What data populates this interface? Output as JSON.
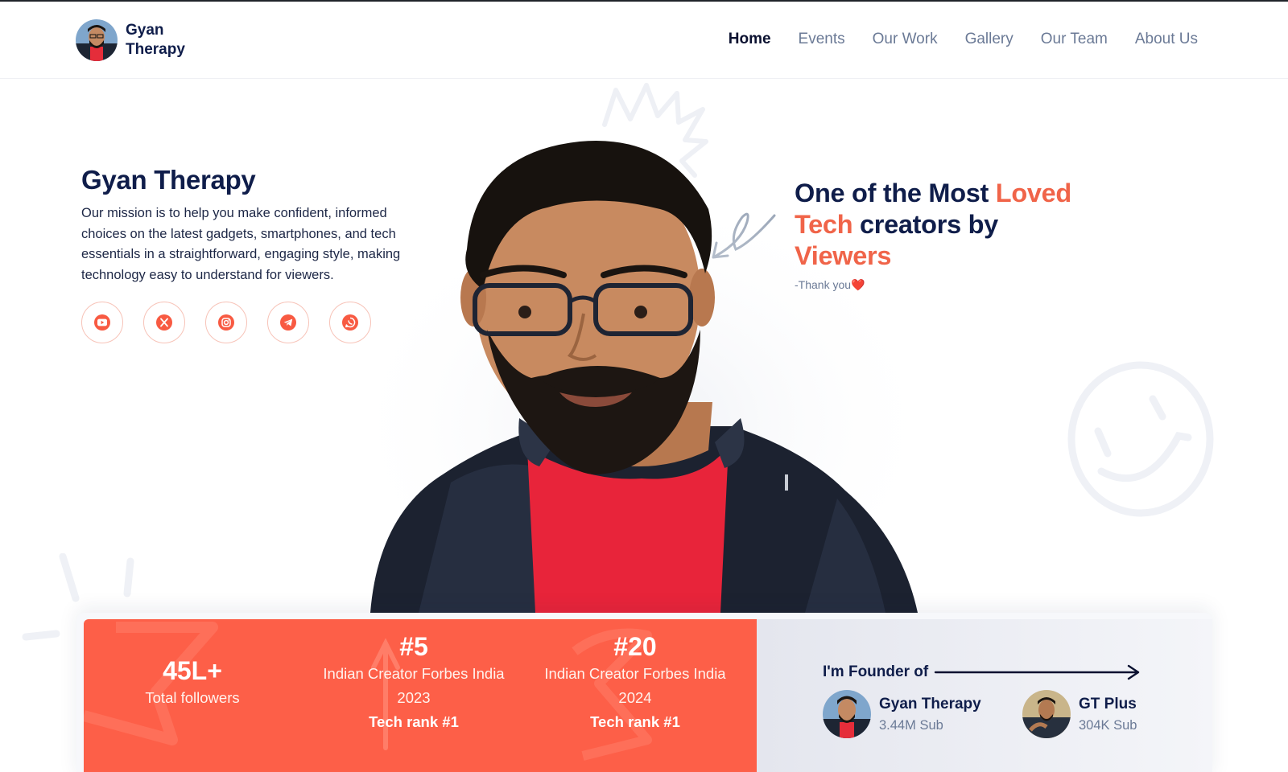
{
  "brand": {
    "name": "Gyan Therapy"
  },
  "nav": {
    "items": [
      {
        "label": "Home",
        "active": true
      },
      {
        "label": "Events"
      },
      {
        "label": "Our Work"
      },
      {
        "label": "Gallery"
      },
      {
        "label": "Our Team"
      },
      {
        "label": "About Us"
      }
    ]
  },
  "hero": {
    "title": "Gyan Therapy",
    "description": "Our mission is to help you make confident, informed choices on the latest gadgets, smartphones, and tech essentials in a straightforward, engaging style, making technology easy to understand for viewers.",
    "socials": [
      "youtube-icon",
      "x-icon",
      "instagram-icon",
      "telegram-icon",
      "whatsapp-icon"
    ]
  },
  "quote": {
    "part1": "One of the Most ",
    "hl1": "Loved",
    "hl2": "Tech",
    "part2": " creators by ",
    "hl3": "Viewers",
    "sub": "-Thank you❤️"
  },
  "stats": {
    "followers": {
      "value": "45L+",
      "label": "Total followers"
    },
    "rank2023": {
      "value": "#5",
      "line1": "Indian Creator Forbes India",
      "line2": "2023",
      "line3": "Tech rank #1"
    },
    "rank2024": {
      "value": "#20",
      "line1": "Indian Creator Forbes India",
      "line2": "2024",
      "line3": "Tech rank #1"
    }
  },
  "founder": {
    "label": "I'm Founder of",
    "channels": [
      {
        "name": "Gyan Therapy",
        "subs": "3.44M Sub"
      },
      {
        "name": "GT Plus",
        "subs": "304K Sub"
      }
    ]
  },
  "colors": {
    "accent": "#fd5f48",
    "navy": "#0f1d4a",
    "muted": "#6b7a96"
  }
}
